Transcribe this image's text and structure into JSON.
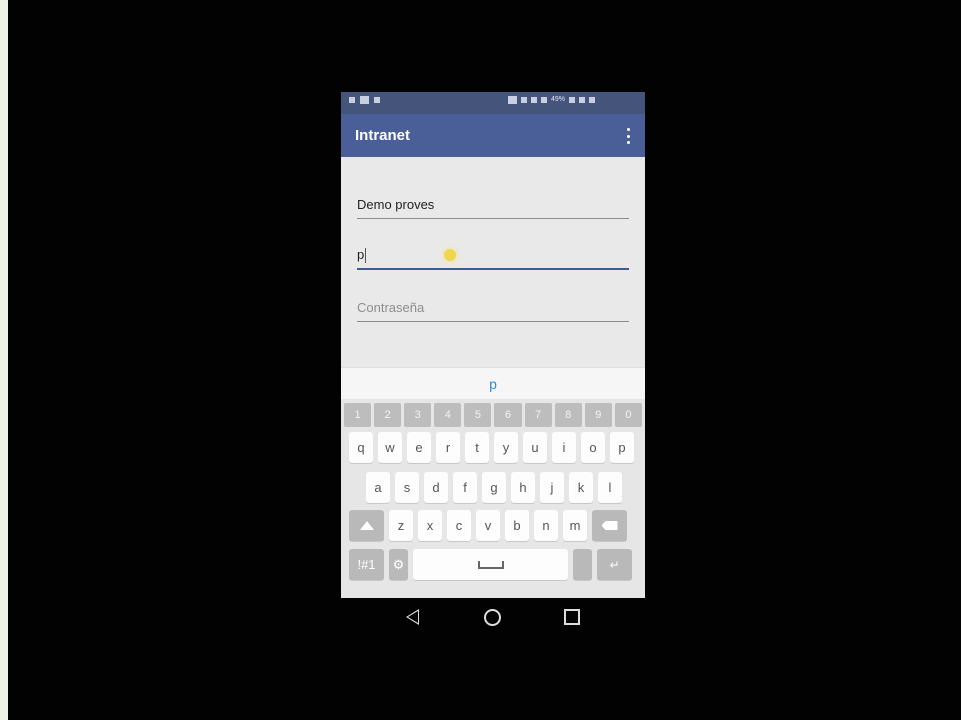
{
  "status_bar": {
    "left_icons": [
      "notification-icon",
      "message-icon",
      "person-icon"
    ],
    "right_text": "49%",
    "right_icons": [
      "nfc-icon",
      "sync-icon",
      "wifi-icon",
      "signal-icon",
      "battery-icon",
      "clock-icon",
      "screen-icon"
    ]
  },
  "app": {
    "title": "Intranet",
    "menu_icon": "more-vert-icon"
  },
  "form": {
    "user_value": "Demo proves",
    "second_value": "p",
    "password_placeholder": "Contraseña"
  },
  "keyboard": {
    "suggestion": "p",
    "number_row": [
      "1",
      "2",
      "3",
      "4",
      "5",
      "6",
      "7",
      "8",
      "9",
      "0"
    ],
    "row1": [
      "q",
      "w",
      "e",
      "r",
      "t",
      "y",
      "u",
      "i",
      "o",
      "p"
    ],
    "row2": [
      "a",
      "s",
      "d",
      "f",
      "g",
      "h",
      "j",
      "k",
      "l"
    ],
    "row3": [
      "z",
      "x",
      "c",
      "v",
      "b",
      "n",
      "m"
    ],
    "symbols_label": "!#1"
  },
  "colors": {
    "status_bar": "#44547a",
    "app_bar": "#4a5f98",
    "accent": "#415a8f",
    "suggestion": "#2e8bd6"
  }
}
